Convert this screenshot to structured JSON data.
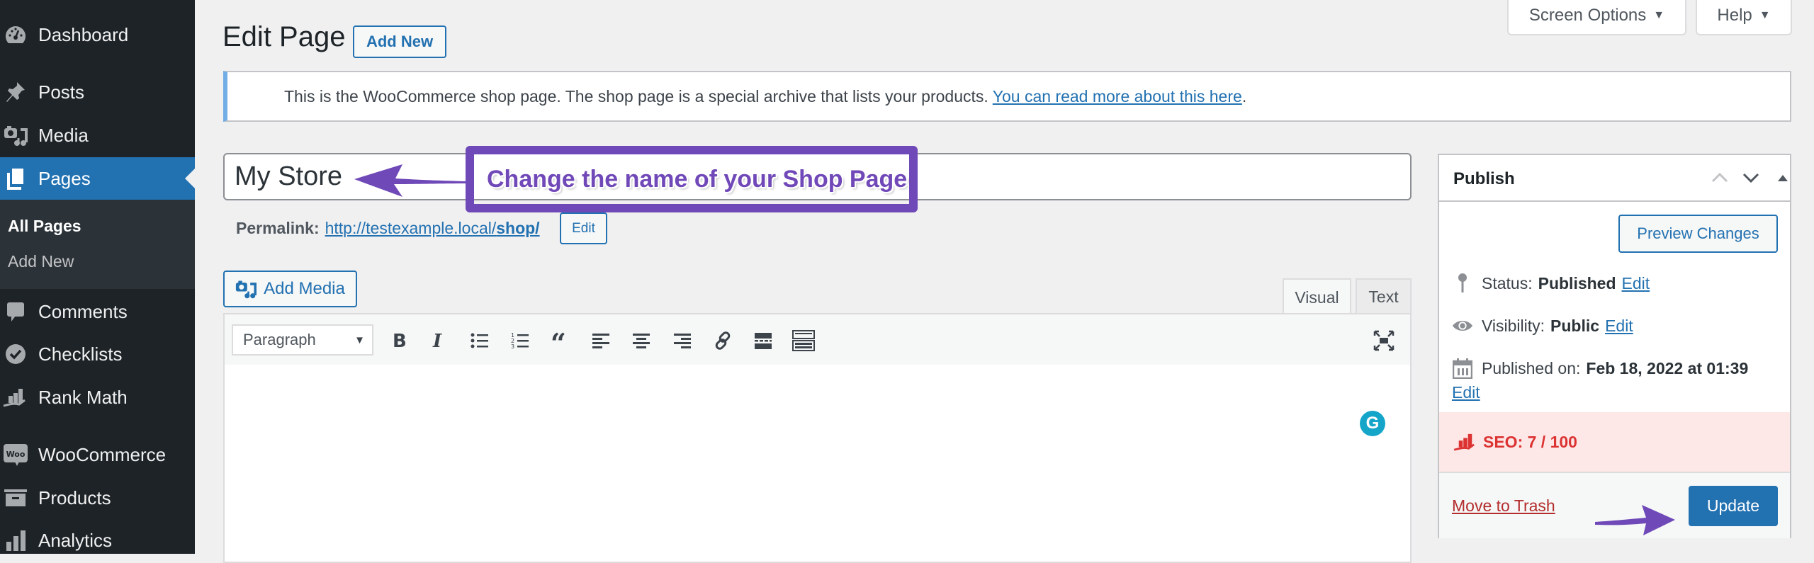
{
  "sidebar": {
    "items": [
      {
        "label": "Dashboard",
        "icon": "dashboard-icon"
      },
      {
        "label": "Posts",
        "icon": "pin-icon"
      },
      {
        "label": "Media",
        "icon": "media-icon"
      },
      {
        "label": "Pages",
        "icon": "pages-icon",
        "active": true
      },
      {
        "label": "Comments",
        "icon": "comment-icon"
      },
      {
        "label": "Checklists",
        "icon": "checklist-icon"
      },
      {
        "label": "Rank Math",
        "icon": "rank-math-icon"
      },
      {
        "label": "WooCommerce",
        "icon": "woocommerce-icon"
      },
      {
        "label": "Products",
        "icon": "archive-box-icon"
      },
      {
        "label": "Analytics",
        "icon": "bar-chart-icon"
      }
    ],
    "submenu": [
      {
        "label": "All Pages",
        "current": true
      },
      {
        "label": "Add New"
      }
    ]
  },
  "header": {
    "title": "Edit Page",
    "add_new_label": "Add New",
    "screen_options_label": "Screen Options",
    "help_label": "Help"
  },
  "notice": {
    "text": "This is the WooCommerce shop page. The shop page is a special archive that lists your products.",
    "link_text": "You can read more about this here",
    "trailing": "."
  },
  "title_field": {
    "value": "My Store"
  },
  "annotation": {
    "text": "Change the name of your Shop Page",
    "color": "#6f49b8"
  },
  "permalink": {
    "label": "Permalink:",
    "url_base": "http://testexample.local/",
    "slug": "shop/",
    "edit_label": "Edit"
  },
  "editor": {
    "add_media_label": "Add Media",
    "tabs": [
      {
        "label": "Visual",
        "active": true
      },
      {
        "label": "Text"
      }
    ],
    "format_select": "Paragraph",
    "toolbar": [
      "bold",
      "italic",
      "bulleted-list",
      "numbered-list",
      "blockquote",
      "align-left",
      "align-center",
      "align-right",
      "link",
      "read-more",
      "toolbar-toggle"
    ],
    "grammarly_glyph": "G"
  },
  "publish": {
    "title": "Publish",
    "preview_label": "Preview Changes",
    "status_label": "Status:",
    "status_value": "Published",
    "visibility_label": "Visibility:",
    "visibility_value": "Public",
    "published_on_label": "Published on:",
    "published_on_value": "Feb 18, 2022 at 01:39",
    "edit_label": "Edit",
    "seo_label": "SEO: 7 / 100",
    "trash_label": "Move to Trash",
    "update_label": "Update"
  },
  "colors": {
    "accent": "#2271b1",
    "sidebar_bg": "#1d2327",
    "seo_red": "#dc3232",
    "annotation_purple": "#6f49b8"
  }
}
